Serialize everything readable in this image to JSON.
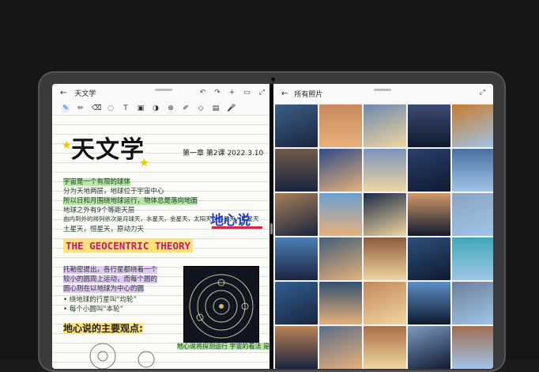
{
  "notes_app": {
    "back_icon": "←",
    "title": "天文学",
    "window_tools": [
      "↶",
      "↷",
      "+",
      "▭",
      "⤢"
    ],
    "toolbar_icons": [
      "pen-icon",
      "pencil-icon",
      "eraser-icon",
      "lasso-icon",
      "text-icon",
      "image-icon",
      "shape-icon",
      "zoom-icon",
      "highlighter-icon",
      "shape2-icon",
      "ruler-icon",
      "mic-icon"
    ],
    "toolbar_glyphs": [
      "✎",
      "✏",
      "⌫",
      "◌",
      "T",
      "▣",
      "◑",
      "⊕",
      "✐",
      "◇",
      "▤",
      "🎤"
    ],
    "heading": "天文学",
    "chapter": "第一章  第2课  2022.3.10",
    "lines": [
      "宇宙是一个有限的球体",
      "分为天地两层，地球位于宇宙中心",
      "所以日和月围绕地球运行，物体总是落向地面",
      "地球之外有9个等距天层",
      "由内到外的排列依次是月球天，水星天，金星天，太阳天，火星天，木星天",
      "土星天，恒星天，原动力天"
    ],
    "geocentric_title": "THE GEOCENTRIC THEORY",
    "dixin_label": "地心说",
    "purple_lines": [
      "托勒密提出，各行星都绕着一个",
      "较小的圆周上运动，而每个圆的",
      "圆心则在以地球为中心的圆"
    ],
    "bullets": [
      "• 绕地球的行星叫“均轮”",
      "• 每个小圆叫“本轮”"
    ],
    "key_points": "地心说的主要观点:",
    "caption": "地心说将探测运行 宇宙的看法 是“球”的!"
  },
  "gallery_app": {
    "back_icon": "←",
    "title": "所有照片",
    "fullscreen_icon": "⤢",
    "photos": [
      "#3b5f86",
      "#c98a5d",
      "#6d88b0",
      "#3d4b72",
      "#c97a2f",
      "#6e5a4a",
      "#2f4c86",
      "#7b93bd",
      "#2a3f6e",
      "#4a6fa0",
      "#a67f58",
      "#6c9fd1",
      "#1c2a48",
      "#d39a6a",
      "#8aa3c0",
      "#4d7fb8",
      "#415f76",
      "#8d5b3d",
      "#2e4f7c",
      "#3fa7b5",
      "#2f5f8f",
      "#34506e",
      "#c4885c",
      "#5d8fc7",
      "#6d7f99",
      "#b98255",
      "#5c6e86",
      "#a96f48",
      "#7d9ac2",
      "#a06d52"
    ]
  }
}
